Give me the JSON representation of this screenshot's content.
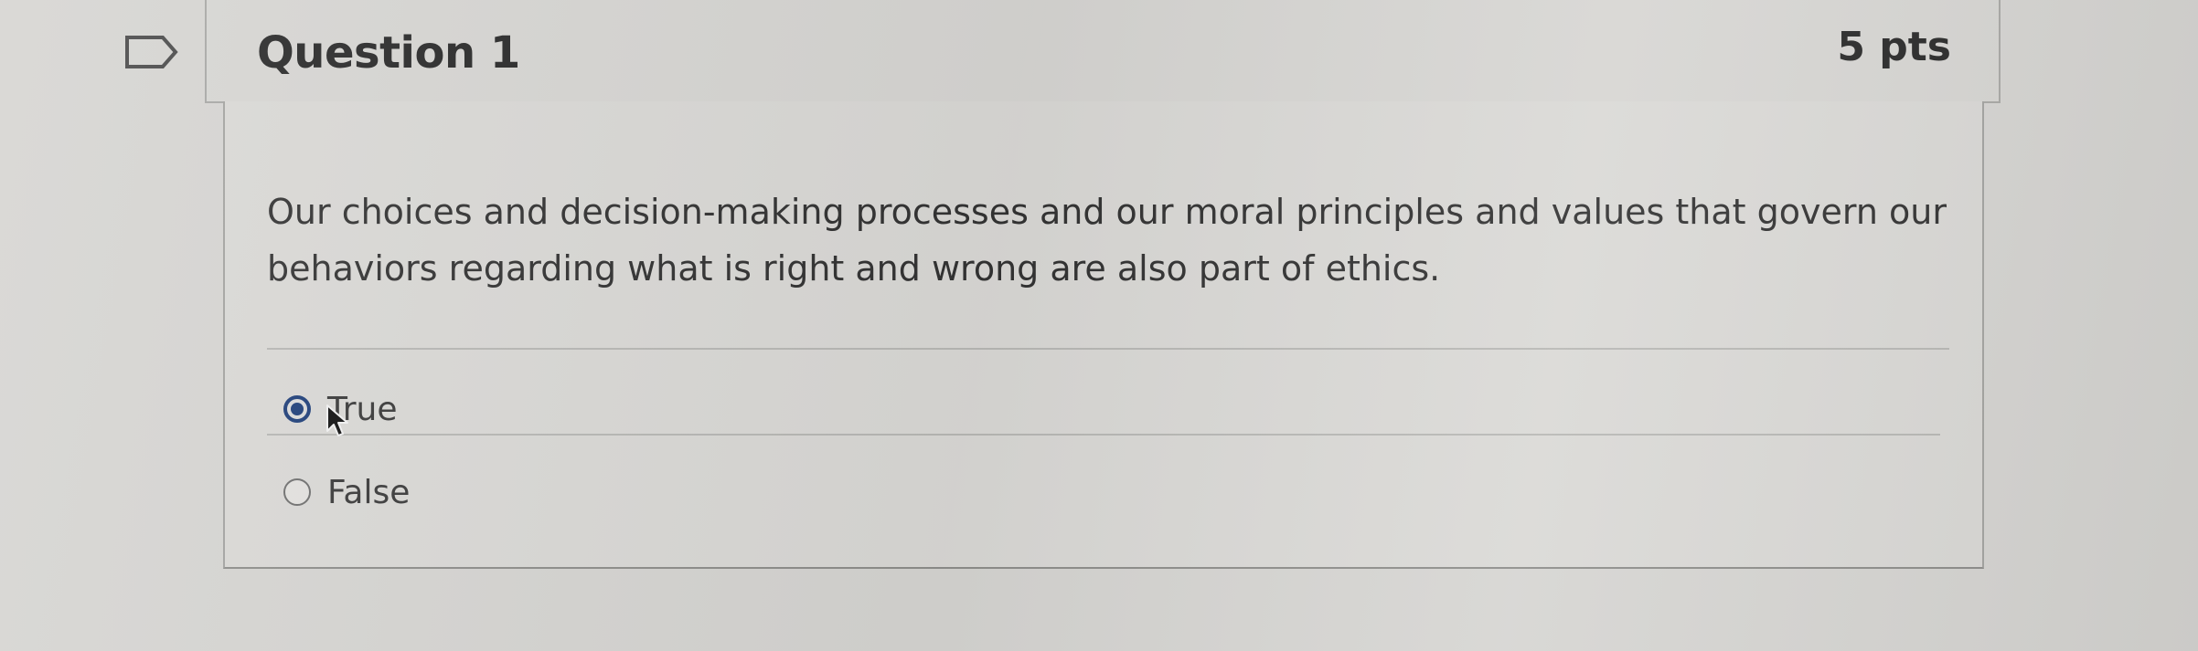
{
  "question": {
    "title": "Question 1",
    "points": "5 pts",
    "text": "Our choices and decision-making processes and our moral principles and values that govern our behaviors regarding what is right and wrong are also part of ethics.",
    "answers": [
      {
        "label": "True",
        "selected": true
      },
      {
        "label": "False",
        "selected": false
      }
    ]
  },
  "icons": {
    "flag": "flag-question-icon",
    "cursor": "mouse-pointer-icon"
  },
  "colors": {
    "page_background": "#d6d5d2",
    "selected_radio": "#1f3f7a",
    "text": "#333333"
  }
}
